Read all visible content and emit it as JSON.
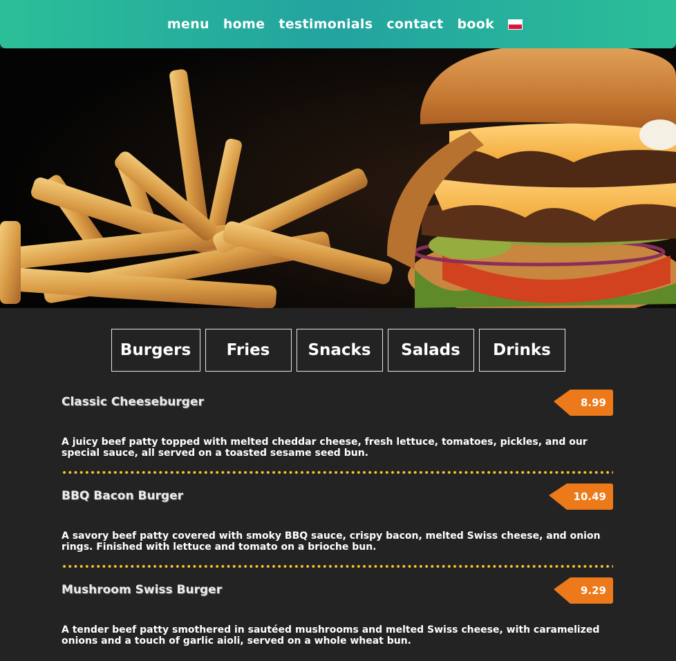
{
  "nav": {
    "links": [
      "menu",
      "home",
      "testimonials",
      "contact",
      "book"
    ],
    "language_flag": "poland-flag-icon"
  },
  "hero": {
    "image": "burger-and-fries-photo"
  },
  "tabs": [
    "Burgers",
    "Fries",
    "Snacks",
    "Salads",
    "Drinks"
  ],
  "menu_items": [
    {
      "name": "Classic Cheeseburger",
      "price": "8.99",
      "description": "A juicy beef patty topped with melted cheddar cheese, fresh lettuce, tomatoes, pickles, and our special sauce, all served on a toasted sesame seed bun."
    },
    {
      "name": "BBQ Bacon Burger",
      "price": "10.49",
      "description": "A savory beef patty covered with smoky BBQ sauce, crispy bacon, melted Swiss cheese, and onion rings. Finished with lettuce and tomato on a brioche bun."
    },
    {
      "name": "Mushroom Swiss Burger",
      "price": "9.29",
      "description": "A tender beef patty smothered in sautéed mushrooms and melted Swiss cheese, with caramelized onions and a touch of garlic aioli, served on a whole wheat bun."
    }
  ],
  "colors": {
    "nav_gradient_start": "#2bbf98",
    "nav_gradient_mid": "#23a3a0",
    "background": "#232323",
    "price_tag": "#ec7a1b",
    "divider_dots": "#f4c430"
  }
}
